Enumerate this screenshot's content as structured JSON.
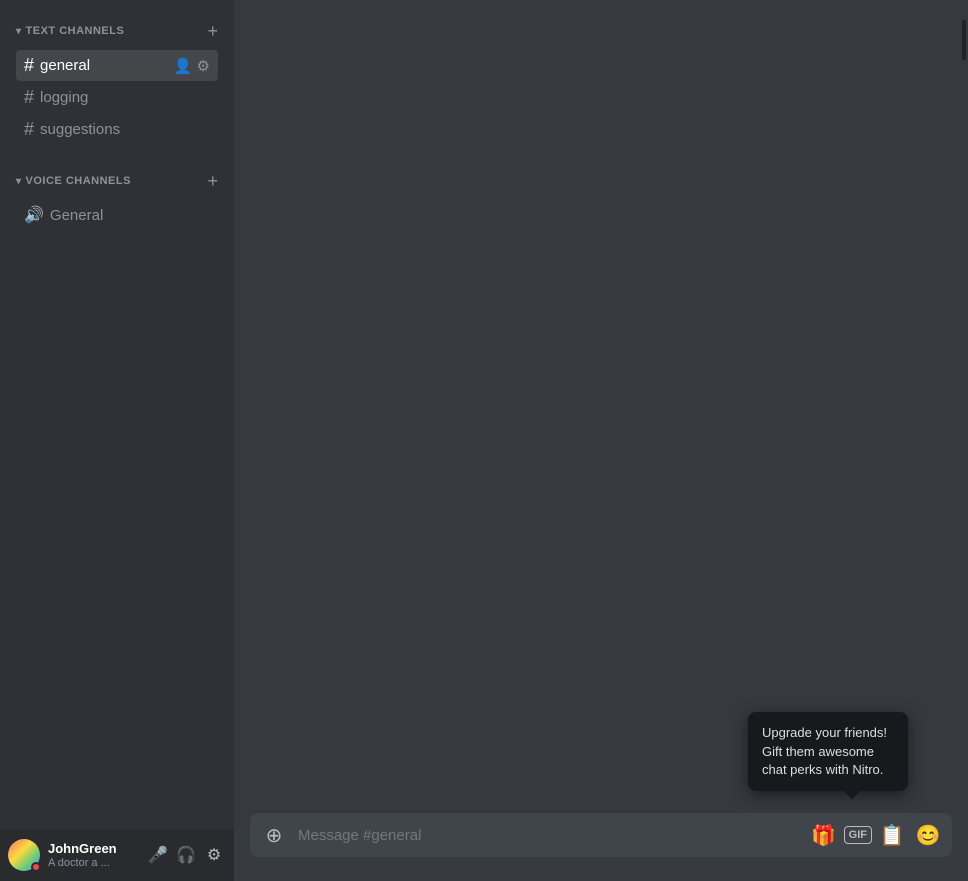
{
  "sidebar": {
    "text_channels_label": "TEXT CHANNELS",
    "voice_channels_label": "VOICE CHANNELS",
    "text_channels": [
      {
        "name": "general",
        "active": true
      },
      {
        "name": "logging",
        "active": false
      },
      {
        "name": "suggestions",
        "active": false
      }
    ],
    "voice_channels": [
      {
        "name": "General"
      }
    ]
  },
  "user": {
    "name": "JohnGreen",
    "status": "A doctor a ...",
    "avatar_bg": "#5865f2"
  },
  "user_controls": {
    "mute_label": "Mute",
    "deafen_label": "Deafen",
    "settings_label": "Settings"
  },
  "message_bar": {
    "placeholder": "Message #general",
    "attach_label": "+",
    "gift_label": "Gift",
    "gif_label": "GIF",
    "sticker_label": "Sticker",
    "emoji_label": "Emoji"
  },
  "tooltip": {
    "text": "Upgrade your friends! Gift them awesome chat perks with Nitro."
  },
  "icons": {
    "chevron_down": "▾",
    "hash": "#",
    "speaker": "🔊",
    "add_member": "👤+",
    "settings": "⚙",
    "mute": "🎤",
    "headphones": "🎧",
    "user_settings": "⚙",
    "add": "+",
    "emoji": "😊",
    "gift": "🎁",
    "sticker": "📄",
    "cursor": "⬤"
  },
  "colors": {
    "active_channel_bg": "rgba(255,255,255,0.1)",
    "sidebar_bg": "#2f3136",
    "main_bg": "#36393f",
    "input_bg": "#40444b",
    "user_area_bg": "#292b2f"
  }
}
